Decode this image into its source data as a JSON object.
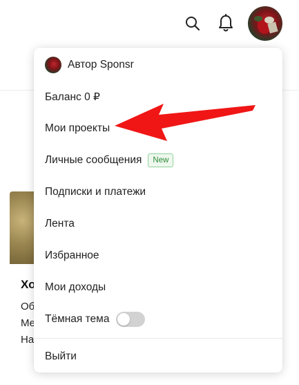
{
  "header": {
    "search_icon": "search-icon",
    "bell_icon": "bell-icon",
    "avatar": "user-avatar"
  },
  "menu": {
    "author_label": "Автор Sponsr",
    "balance_label": "Баланс 0 ₽",
    "projects_label": "Мои проекты",
    "messages_label": "Личные сообщения",
    "messages_badge": "New",
    "subscriptions_label": "Подписки и платежи",
    "feed_label": "Лента",
    "favorites_label": "Избранное",
    "income_label": "Мои доходы",
    "dark_theme_label": "Тёмная тема",
    "dark_theme_enabled": false,
    "logout_label": "Выйти"
  },
  "background_card": {
    "title": "Хо",
    "line1": "Об",
    "line2": "Ме",
    "line3": "На"
  },
  "colors": {
    "annotation_arrow": "#f01616",
    "new_badge": "#2e8b3a"
  }
}
